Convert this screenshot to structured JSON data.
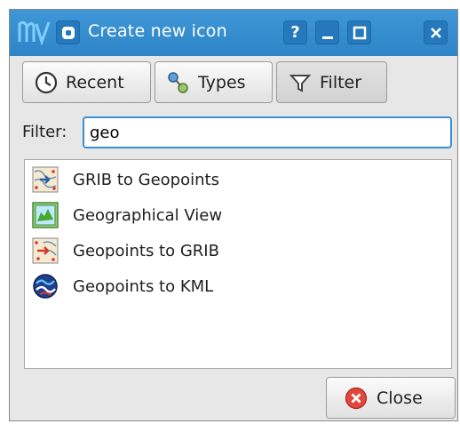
{
  "window": {
    "title": "Create new icon",
    "help_label": "?"
  },
  "tabs": [
    {
      "label": "Recent",
      "icon": "clock-icon",
      "active": false
    },
    {
      "label": "Types",
      "icon": "types-icon",
      "active": false
    },
    {
      "label": "Filter",
      "icon": "filter-icon",
      "active": true
    }
  ],
  "filter": {
    "label": "Filter:",
    "value": "geo"
  },
  "results": [
    {
      "label": "GRIB to Geopoints",
      "icon": "grib-to-geopoints-icon"
    },
    {
      "label": "Geographical View",
      "icon": "geographical-view-icon"
    },
    {
      "label": "Geopoints to GRIB",
      "icon": "geopoints-to-grib-icon"
    },
    {
      "label": "Geopoints to KML",
      "icon": "geopoints-to-kml-icon"
    }
  ],
  "close_button": {
    "label": "Close",
    "icon": "close-circle-icon"
  },
  "colors": {
    "titlebar": "#3188cb",
    "focus": "#3a8fd6",
    "close_icon": "#e0483e"
  }
}
